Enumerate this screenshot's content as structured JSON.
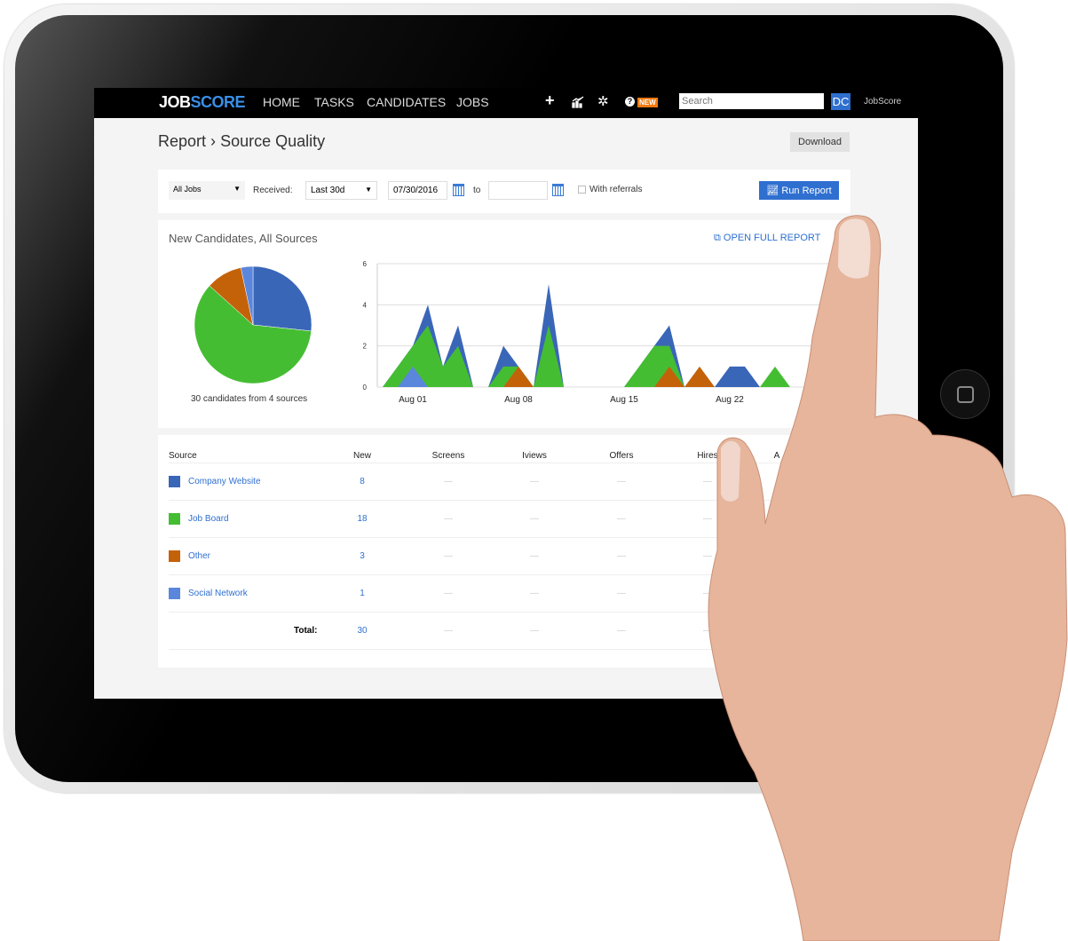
{
  "nav": {
    "logo_left": "JOB",
    "logo_right": "SCORE",
    "items": [
      "HOME",
      "TASKS",
      "CANDIDATES",
      "JOBS"
    ],
    "icons": [
      "plus-icon",
      "chart-icon",
      "gear-icon",
      "help-icon"
    ],
    "new_badge": "NEW",
    "search_placeholder": "Search",
    "avatar": "DC",
    "account": "JobScore"
  },
  "page": {
    "title_prefix": "Report",
    "separator": "›",
    "title": "Source Quality",
    "download": "Download"
  },
  "filters": {
    "jobs": "All Jobs",
    "received_label": "Received:",
    "range": "Last 30d",
    "from_date": "07/30/2016",
    "to_label": "to",
    "to_date": "",
    "referrals_label": "With referrals",
    "referrals_checked": false,
    "run": "Run Report"
  },
  "chart_panel": {
    "title": "New Candidates, All Sources",
    "open_full": "OPEN FULL REPORT",
    "pie_caption": "30 candidates from 4 sources"
  },
  "colors": {
    "Company Website": "#3a66b8",
    "Job Board": "#45bd32",
    "Other": "#c4620a",
    "Social Network": "#5a86dc"
  },
  "chart_data": [
    {
      "type": "pie",
      "slices": [
        {
          "label": "Company Website",
          "value": 8
        },
        {
          "label": "Job Board",
          "value": 18
        },
        {
          "label": "Other",
          "value": 3
        },
        {
          "label": "Social Network",
          "value": 1
        }
      ]
    },
    {
      "type": "area",
      "ylim": [
        0,
        6
      ],
      "yticks": [
        0,
        2,
        4,
        6
      ],
      "xticks": [
        "Aug 01",
        "Aug 08",
        "Aug 15",
        "Aug 22"
      ],
      "grid": true,
      "dates": [
        "Jul 30",
        "Jul 31",
        "Aug 01",
        "Aug 02",
        "Aug 03",
        "Aug 04",
        "Aug 05",
        "Aug 06",
        "Aug 07",
        "Aug 08",
        "Aug 09",
        "Aug 10",
        "Aug 11",
        "Aug 12",
        "Aug 13",
        "Aug 14",
        "Aug 15",
        "Aug 16",
        "Aug 17",
        "Aug 18",
        "Aug 19",
        "Aug 20",
        "Aug 21",
        "Aug 22",
        "Aug 23",
        "Aug 24",
        "Aug 25",
        "Aug 26"
      ],
      "series": [
        {
          "name": "Company Website",
          "values": [
            0,
            1,
            2,
            4,
            1,
            3,
            0,
            0,
            2,
            1,
            0,
            5,
            0,
            0,
            0,
            0,
            0,
            1,
            2,
            3,
            0,
            0,
            0,
            1,
            1,
            0,
            0,
            0
          ]
        },
        {
          "name": "Job Board",
          "values": [
            0,
            1,
            2,
            3,
            1,
            2,
            0,
            0,
            1,
            1,
            0,
            3,
            0,
            0,
            0,
            0,
            0,
            1,
            2,
            2,
            0,
            0,
            0,
            0,
            0,
            0,
            1,
            0
          ]
        },
        {
          "name": "Other",
          "values": [
            0,
            0,
            0,
            0,
            0,
            0,
            0,
            0,
            0,
            1,
            0,
            0,
            0,
            0,
            0,
            0,
            0,
            0,
            0,
            1,
            0,
            1,
            0,
            0,
            0,
            0,
            0,
            0
          ]
        },
        {
          "name": "Social Network",
          "values": [
            0,
            0,
            1,
            0,
            0,
            0,
            0,
            0,
            0,
            0,
            0,
            0,
            0,
            0,
            0,
            0,
            0,
            0,
            0,
            0,
            0,
            0,
            0,
            0,
            0,
            0,
            0,
            0
          ]
        }
      ]
    }
  ],
  "table": {
    "headers": [
      "Source",
      "New",
      "Screens",
      "Iviews",
      "Offers",
      "Hires",
      "A"
    ],
    "rows": [
      {
        "source": "Company Website",
        "new": "8",
        "screens": "—",
        "iviews": "—",
        "offers": "—",
        "hires": "—"
      },
      {
        "source": "Job Board",
        "new": "18",
        "screens": "—",
        "iviews": "—",
        "offers": "—",
        "hires": "—"
      },
      {
        "source": "Other",
        "new": "3",
        "screens": "—",
        "iviews": "—",
        "offers": "—",
        "hires": "—"
      },
      {
        "source": "Social Network",
        "new": "1",
        "screens": "—",
        "iviews": "—",
        "offers": "—",
        "hires": "—"
      }
    ],
    "total_label": "Total:",
    "total": {
      "new": "30",
      "screens": "—",
      "iviews": "—",
      "offers": "—",
      "hires": "—"
    }
  }
}
